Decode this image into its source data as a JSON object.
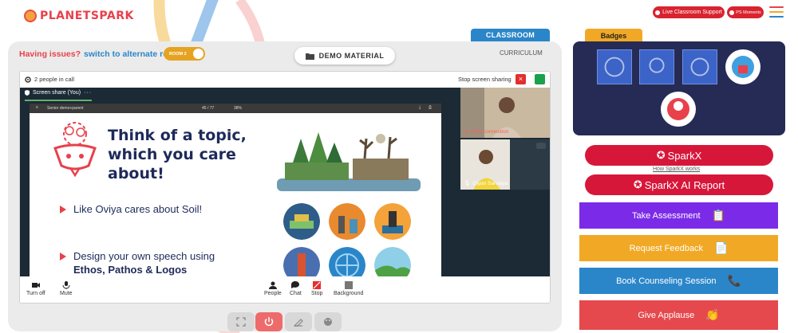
{
  "brand": {
    "logo_text": "PLANETSPARK"
  },
  "header": {
    "live_support_label": "Live Classroom Support",
    "ps_moments_label": "PS Moments",
    "menu_icon": "hamburger-icon",
    "menu_colors": [
      "#e8414b",
      "#f1a925",
      "#2a86c9",
      "#1aa14c"
    ]
  },
  "room_bar": {
    "issue_text": "Having issues?",
    "switch_link": "switch to alternate room",
    "room_toggle_label": "ROOM 2",
    "demo_material_label": "DEMO MATERIAL",
    "classroom_tab": "CLASSROOM",
    "curriculum_label": "CURRICULUM"
  },
  "call": {
    "people_count": "2 people in call",
    "stop_sharing_label": "Stop screen sharing",
    "screen_share_tab": "Screen share (You)",
    "pdf_name": "Senior demo+parent",
    "pdf_page": "45 / 77",
    "pdf_zoom": "38%",
    "participants": [
      {
        "status": "Poor connection"
      },
      {
        "name": "Giyan Sarvaiya"
      }
    ],
    "controls": {
      "turn_off": "Turn off",
      "mute": "Mute",
      "people": "People",
      "chat": "Chat",
      "stop": "Stop",
      "background": "Background"
    }
  },
  "slide": {
    "title": "Think of a topic, which you care about!",
    "bullet1": "Like Oviya cares about Soil!",
    "bullet2_plain": "Design your own speech using",
    "bullet2_bold": "Ethos, Pathos & Logos"
  },
  "badges": {
    "title": "Badges"
  },
  "actions": {
    "sparkx": "SparkX",
    "how_sparkx": "How SparkX works",
    "sparkx_report": "SparkX AI Report",
    "take_assessment": "Take Assessment",
    "request_feedback": "Request Feedback",
    "book_counseling": "Book Counseling Session",
    "give_applause": "Give Applause"
  },
  "colors": {
    "accent_red": "#d7173a",
    "purple": "#7b2be8",
    "orange": "#f1a925",
    "blue": "#2a86c9",
    "coral": "#e5484d",
    "navy": "#252b55"
  }
}
